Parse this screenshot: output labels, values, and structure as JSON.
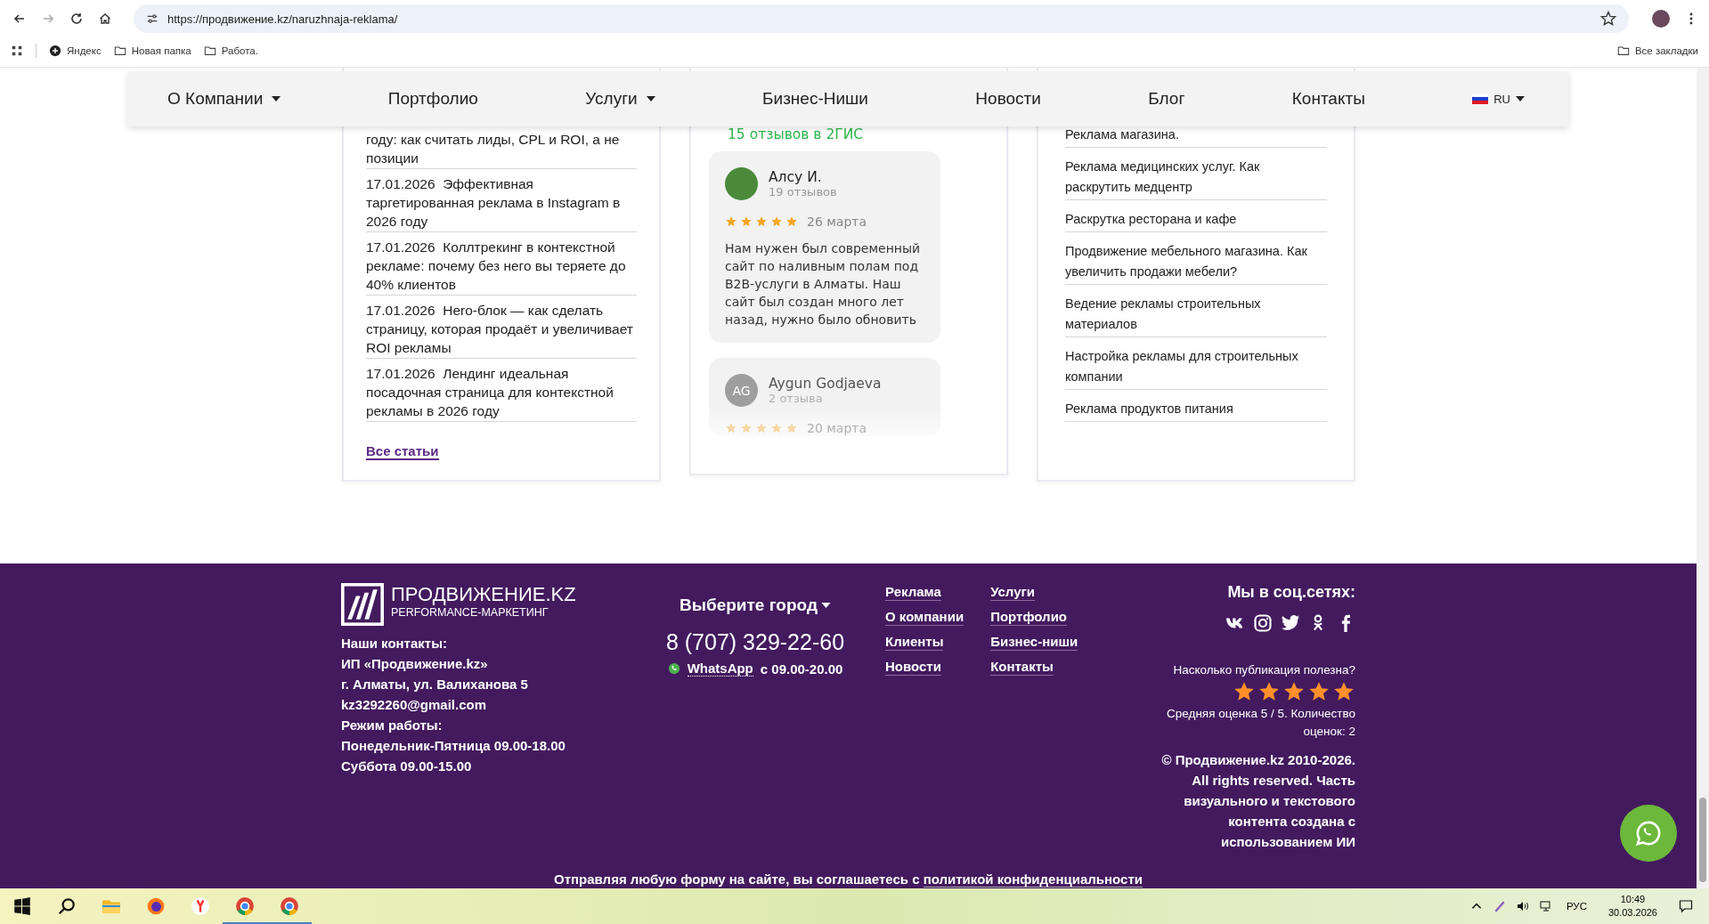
{
  "browser": {
    "url": "https://продвижение.kz/naruzhnaja-reklama/",
    "bookmarks": [
      "Яндекс",
      "Новая папка",
      "Работа."
    ],
    "all_bookmarks": "Все закладки"
  },
  "nav": {
    "items": [
      {
        "label": "О Компании",
        "dropdown": true
      },
      {
        "label": "Портфолио",
        "dropdown": false
      },
      {
        "label": "Услуги",
        "dropdown": true
      },
      {
        "label": "Бизнес-Ниши",
        "dropdown": false
      },
      {
        "label": "Новости",
        "dropdown": false
      },
      {
        "label": "Блог",
        "dropdown": false
      },
      {
        "label": "Контакты",
        "dropdown": false
      }
    ],
    "lang": "RU"
  },
  "articles": {
    "items": [
      {
        "title": "году: как считать лиды, CPL и ROI, а не позиции"
      },
      {
        "date": "17.01.2026",
        "title": "Эффективная таргетированная реклама в Instagram в 2026 году"
      },
      {
        "date": "17.01.2026",
        "title": "Коллтрекинг в контекстной рекламе: почему без него вы теряете до 40% клиентов"
      },
      {
        "date": "17.01.2026",
        "title": "Hero-блок — как сделать страницу, которая продаёт и увеличивает ROI рекламы"
      },
      {
        "date": "17.01.2026",
        "title": "Лендинг идеальная посадочная страница для контекстной рекламы в 2026 году"
      }
    ],
    "all_link": "Все статьи"
  },
  "reviews": {
    "count_link": "15 отзывов в 2ГИС",
    "items": [
      {
        "kind": "photo",
        "name": "Алсу И.",
        "count": "19 отзывов",
        "stars": 5,
        "date": "26 марта",
        "text": "Нам нужен был современный сайт по наливным полам под B2B-услуги в Алматы. Наш сайт был создан много лет назад, нужно было обновить",
        "faded": false
      },
      {
        "kind": "initials",
        "initials": "AG",
        "name": "Aygun Godjaeva",
        "count": "2 отзыва",
        "stars": 5,
        "date": "20 марта",
        "faded": true
      }
    ]
  },
  "services": [
    "Реклама магазина.",
    "Реклама медицинских услуг. Как раскрутить медцентр",
    "Раскрутка ресторана и кафе",
    "Продвижение мебельного магазина. Как увеличить продажи мебели?",
    "Ведение рекламы строительных материалов",
    "Настройка рекламы для строительных компании",
    "Реклама продуктов питания"
  ],
  "footer": {
    "logo": {
      "name": "ПРОДВИЖЕНИЕ.KZ",
      "tagline": "PERFORMANCE-МАРКЕТИНГ"
    },
    "contacts": [
      "Наши контакты:",
      "ИП «Продвижение.kz»",
      "г. Алматы, ул. Валиханова 5",
      "kz3292260@gmail.com",
      "Режим работы:",
      "Понедельник-Пятница 09.00-18.00",
      "Суббота 09.00-15.00"
    ],
    "city_select": "Выберите город",
    "phone": "8 (707) 329-22-60",
    "whatsapp": {
      "label": "WhatsApp",
      "hours": "с 09.00-20.00"
    },
    "link_columns": [
      [
        "Реклама",
        "О компании",
        "Клиенты",
        "Новости"
      ],
      [
        "Услуги",
        "Портфолио",
        "Бизнес-ниши",
        "Контакты"
      ]
    ],
    "social_heading": "Мы в соц.сетях:",
    "rating": {
      "question": "Насколько публикация полезна?",
      "stars": 5,
      "summary": "Средняя оценка 5 / 5. Количество оценок: 2"
    },
    "copyright": "© Продвижение.kz 2010-2026. All rights reserved. Часть визуального и текстового контента создана с использованием ИИ",
    "privacy": {
      "text": "Отправляя любую форму на сайте, вы соглашаетесь с",
      "link": "политикой конфиденциальности"
    }
  },
  "taskbar": {
    "lang": "РУС",
    "time": "10:49",
    "date": "30.03.2026"
  }
}
